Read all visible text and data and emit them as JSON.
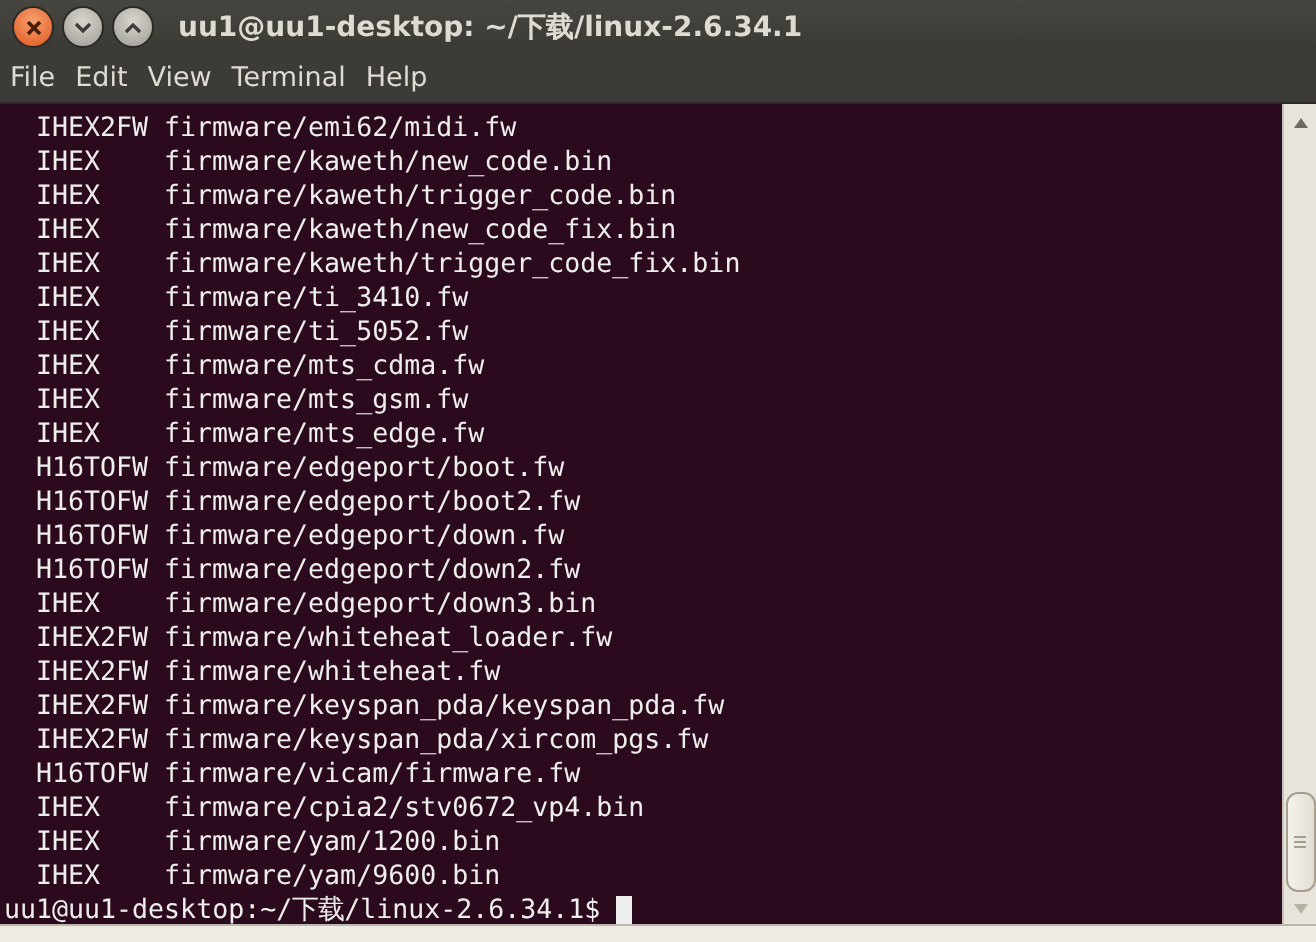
{
  "window": {
    "title": "uu1@uu1-desktop: ~/下载/linux-2.6.34.1"
  },
  "menu": [
    "File",
    "Edit",
    "View",
    "Terminal",
    "Help"
  ],
  "output": [
    {
      "tool": "IHEX2FW",
      "path": "firmware/emi62/midi.fw"
    },
    {
      "tool": "IHEX",
      "path": "firmware/kaweth/new_code.bin"
    },
    {
      "tool": "IHEX",
      "path": "firmware/kaweth/trigger_code.bin"
    },
    {
      "tool": "IHEX",
      "path": "firmware/kaweth/new_code_fix.bin"
    },
    {
      "tool": "IHEX",
      "path": "firmware/kaweth/trigger_code_fix.bin"
    },
    {
      "tool": "IHEX",
      "path": "firmware/ti_3410.fw"
    },
    {
      "tool": "IHEX",
      "path": "firmware/ti_5052.fw"
    },
    {
      "tool": "IHEX",
      "path": "firmware/mts_cdma.fw"
    },
    {
      "tool": "IHEX",
      "path": "firmware/mts_gsm.fw"
    },
    {
      "tool": "IHEX",
      "path": "firmware/mts_edge.fw"
    },
    {
      "tool": "H16TOFW",
      "path": "firmware/edgeport/boot.fw"
    },
    {
      "tool": "H16TOFW",
      "path": "firmware/edgeport/boot2.fw"
    },
    {
      "tool": "H16TOFW",
      "path": "firmware/edgeport/down.fw"
    },
    {
      "tool": "H16TOFW",
      "path": "firmware/edgeport/down2.fw"
    },
    {
      "tool": "IHEX",
      "path": "firmware/edgeport/down3.bin"
    },
    {
      "tool": "IHEX2FW",
      "path": "firmware/whiteheat_loader.fw"
    },
    {
      "tool": "IHEX2FW",
      "path": "firmware/whiteheat.fw"
    },
    {
      "tool": "IHEX2FW",
      "path": "firmware/keyspan_pda/keyspan_pda.fw"
    },
    {
      "tool": "IHEX2FW",
      "path": "firmware/keyspan_pda/xircom_pgs.fw"
    },
    {
      "tool": "H16TOFW",
      "path": "firmware/vicam/firmware.fw"
    },
    {
      "tool": "IHEX",
      "path": "firmware/cpia2/stv0672_vp4.bin"
    },
    {
      "tool": "IHEX",
      "path": "firmware/yam/1200.bin"
    },
    {
      "tool": "IHEX",
      "path": "firmware/yam/9600.bin"
    }
  ],
  "prompt": "uu1@uu1-desktop:~/下载/linux-2.6.34.1$"
}
